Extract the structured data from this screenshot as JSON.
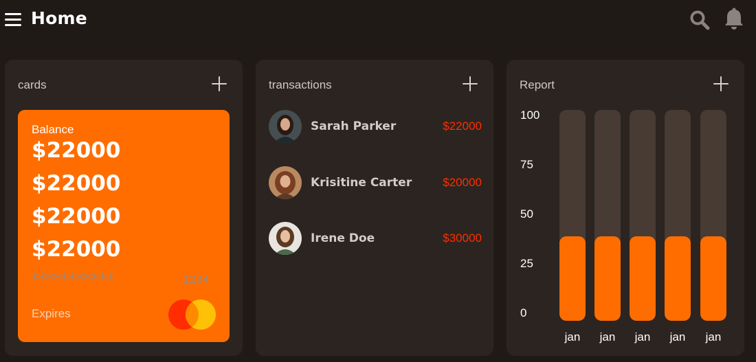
{
  "header": {
    "title": "Home",
    "menu_icon": "hamburger-menu-icon",
    "search_icon": "search-icon",
    "notification_icon": "bell-icon"
  },
  "colors": {
    "background": "#201a17",
    "panel": "#2c2420",
    "accent": "#ff6d00",
    "negative_amount": "#ff2d00"
  },
  "cards": {
    "title": "cards",
    "add_icon": "plus-icon",
    "card": {
      "label": "Balance",
      "amounts": [
        "$22000",
        "$22000",
        "$22000",
        "$22000"
      ],
      "masked_number": "***********",
      "last4": "1234",
      "expires_label": "Expires",
      "brand_icon": "mastercard-icon"
    }
  },
  "transactions": {
    "title": "transactions",
    "add_icon": "plus-icon",
    "items": [
      {
        "name": "Sarah Parker",
        "amount": "$22000"
      },
      {
        "name": "Krisitine Carter",
        "amount": "$20000"
      },
      {
        "name": "Irene Doe",
        "amount": "$30000"
      }
    ]
  },
  "report": {
    "title": "Report",
    "add_icon": "plus-icon",
    "y_ticks": [
      "100",
      "75",
      "50",
      "25",
      "0"
    ],
    "x_labels": [
      "jan",
      "jan",
      "jan",
      "jan",
      "jan"
    ]
  },
  "chart_data": {
    "type": "bar",
    "title": "Report",
    "categories": [
      "jan",
      "jan",
      "jan",
      "jan",
      "jan"
    ],
    "values": [
      40,
      40,
      40,
      40,
      40
    ],
    "ylim": [
      0,
      100
    ],
    "yticks": [
      0,
      25,
      50,
      75,
      100
    ],
    "grid": false
  }
}
